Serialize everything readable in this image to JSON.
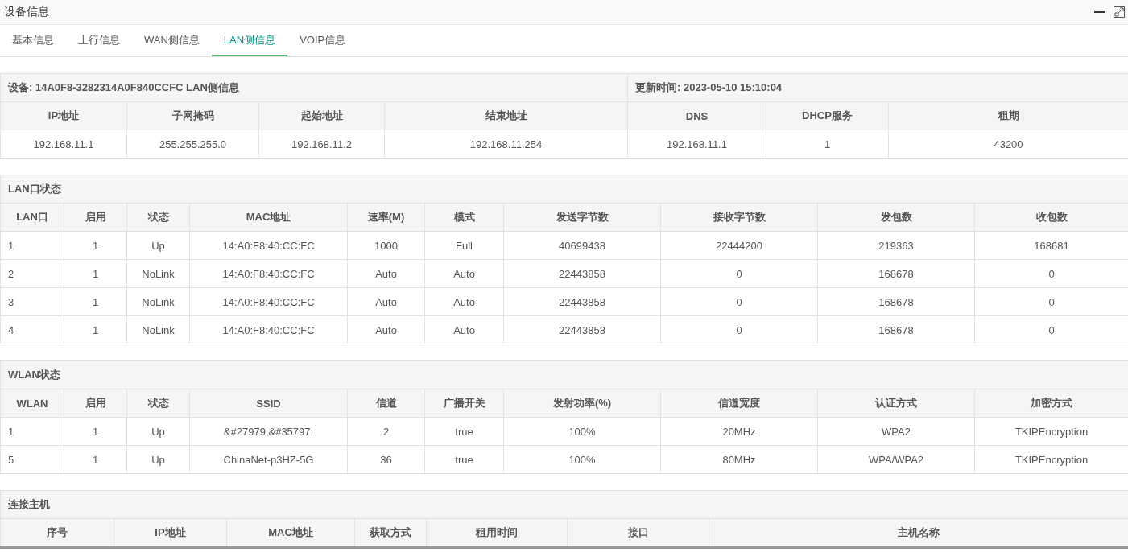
{
  "header": {
    "title": "设备信息"
  },
  "tabs": [
    {
      "label": "基本信息",
      "selected": false
    },
    {
      "label": "上行信息",
      "selected": false
    },
    {
      "label": "WAN侧信息",
      "selected": false
    },
    {
      "label": "LAN侧信息",
      "selected": true
    },
    {
      "label": "VOIP信息",
      "selected": false
    }
  ],
  "sections": [
    {
      "title_cells": [
        "设备: 14A0F8-3282314A0F840CCFC LAN侧信息",
        "更新时间: 2023-05-10 15:10:04"
      ],
      "columns": [
        "IP地址",
        "子网掩码",
        "起始地址",
        "结束地址",
        "DNS",
        "DHCP服务",
        "租期"
      ],
      "rows": [
        [
          "192.168.11.1",
          "255.255.255.0",
          "192.168.11.2",
          "192.168.11.254",
          "192.168.11.1",
          "1",
          "43200"
        ]
      ]
    },
    {
      "title_cells": [
        "LAN口状态"
      ],
      "columns": [
        "LAN口",
        "启用",
        "状态",
        "MAC地址",
        "速率(M)",
        "模式",
        "发送字节数",
        "接收字节数",
        "发包数",
        "收包数"
      ],
      "rows": [
        [
          "1",
          "1",
          "Up",
          "14:A0:F8:40:CC:FC",
          "1000",
          "Full",
          "40699438",
          "22444200",
          "219363",
          "168681"
        ],
        [
          "2",
          "1",
          "NoLink",
          "14:A0:F8:40:CC:FC",
          "Auto",
          "Auto",
          "22443858",
          "0",
          "168678",
          "0"
        ],
        [
          "3",
          "1",
          "NoLink",
          "14:A0:F8:40:CC:FC",
          "Auto",
          "Auto",
          "22443858",
          "0",
          "168678",
          "0"
        ],
        [
          "4",
          "1",
          "NoLink",
          "14:A0:F8:40:CC:FC",
          "Auto",
          "Auto",
          "22443858",
          "0",
          "168678",
          "0"
        ]
      ]
    },
    {
      "title_cells": [
        "WLAN状态"
      ],
      "columns": [
        "WLAN",
        "启用",
        "状态",
        "SSID",
        "信道",
        "广播开关",
        "发射功率(%)",
        "信道宽度",
        "认证方式",
        "加密方式"
      ],
      "rows": [
        [
          "1",
          "1",
          "Up",
          "&#27979;&#35797;",
          "2",
          "true",
          "100%",
          "20MHz",
          "WPA2",
          "TKIPEncryption"
        ],
        [
          "5",
          "1",
          "Up",
          "ChinaNet-p3HZ-5G",
          "36",
          "true",
          "100%",
          "80MHz",
          "WPA/WPA2",
          "TKIPEncryption"
        ]
      ]
    },
    {
      "title_cells": [
        "连接主机"
      ],
      "columns": [
        "序号",
        "IP地址",
        "MAC地址",
        "获取方式",
        "租用时间",
        "接口",
        "主机名称"
      ]
    }
  ]
}
